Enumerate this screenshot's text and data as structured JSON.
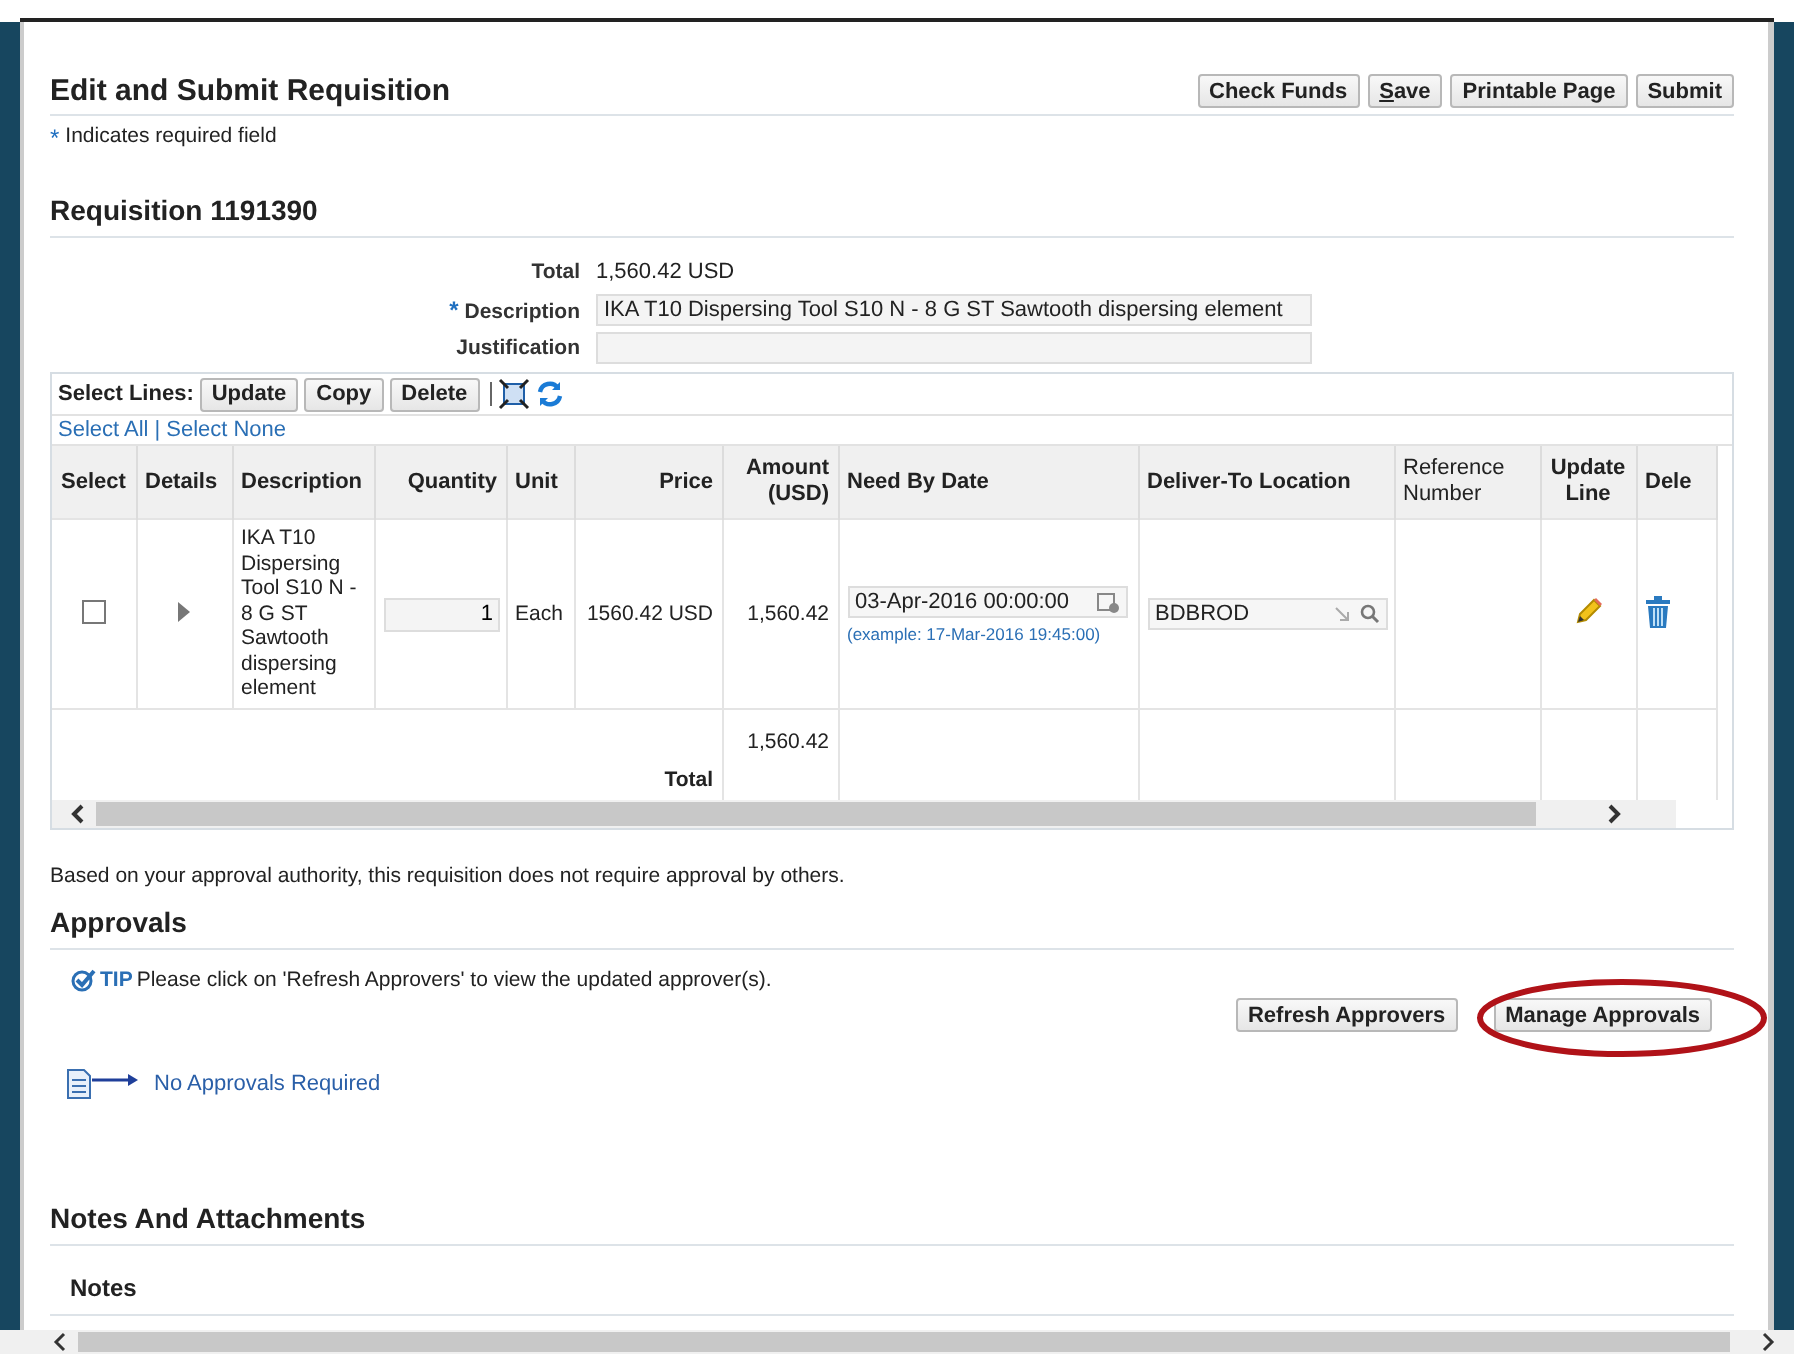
{
  "page": {
    "title": "Edit and Submit Requisition",
    "required_mark": "*",
    "required_note": "Indicates required field"
  },
  "actions": [
    {
      "label": "Check Funds",
      "mnemonic_first": false
    },
    {
      "label": "Save",
      "mnemonic_first": true
    },
    {
      "label": "Printable Page",
      "mnemonic_first": false
    },
    {
      "label": "Submit",
      "mnemonic_first": false
    }
  ],
  "requisition": {
    "heading": "Requisition 1191390",
    "fields": [
      {
        "kind": "text",
        "label": "Total",
        "required": false,
        "value": "1,560.42 USD"
      },
      {
        "kind": "input",
        "label": "Description",
        "required": true,
        "value": "IKA T10 Dispersing Tool S10 N - 8 G ST Sawtooth dispersing element"
      },
      {
        "kind": "input",
        "label": "Justification",
        "required": false
      }
    ]
  },
  "lines": {
    "toolbar_label": "Select Lines:",
    "buttons": [
      "Update",
      "Copy",
      "Delete"
    ],
    "select_all": "Select All",
    "link_separator": "|",
    "select_none": "Select None",
    "columns": [
      "Select",
      "Details",
      "Description",
      "Quantity",
      "Unit",
      "Price",
      "Amount (USD)",
      "Need By Date",
      "Deliver-To Location",
      "Reference Number",
      "Update Line",
      "Dele"
    ],
    "rows": [
      {
        "selected": false,
        "description": "IKA T10 Dispersing Tool S10 N - 8 G ST Sawtooth dispersing element",
        "quantity": "1",
        "unit": "Each",
        "price": "1560.42 USD",
        "amount": "1,560.42",
        "need_by_date": "03-Apr-2016 00:00:00",
        "date_hint": "(example: 17-Mar-2016 19:45:00)",
        "deliver_to": "BDBROD"
      }
    ],
    "total_label": "Total",
    "total_amount": "1,560.42"
  },
  "approval_message": "Based on your approval authority, this requisition does not require approval by others.",
  "approvals": {
    "heading": "Approvals",
    "tip_label": "TIP",
    "tip_text": "Please click on 'Refresh Approvers' to view the updated approver(s).",
    "buttons": [
      "Refresh Approvers",
      "Manage Approvals"
    ],
    "status_link": "No Approvals Required"
  },
  "notes": {
    "heading": "Notes And Attachments",
    "subheading": "Notes"
  }
}
